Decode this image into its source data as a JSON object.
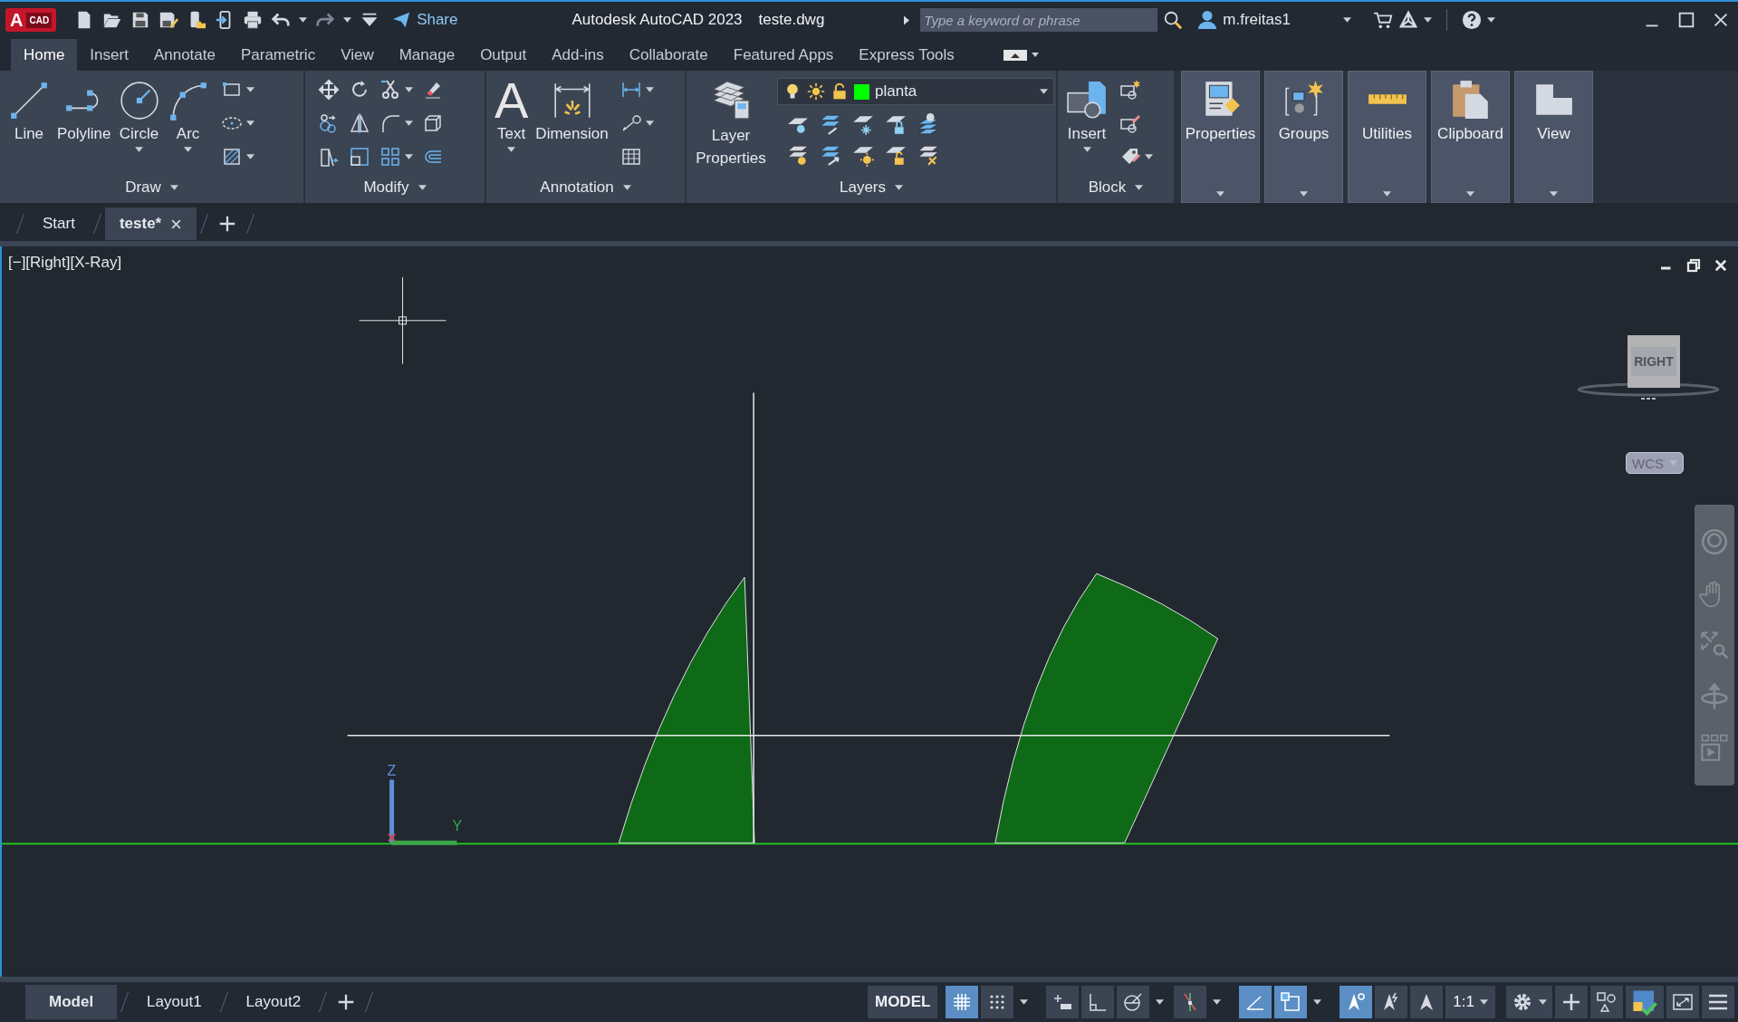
{
  "title_bar": {
    "app_badge": "A",
    "app_badge_sub": "CAD",
    "share": "Share",
    "title": "Autodesk AutoCAD 2023",
    "file_name": "teste.dwg",
    "search": {
      "placeholder": "Type a keyword or phrase"
    },
    "user": "m.freitas1"
  },
  "ribbon_tabs": [
    {
      "label": "Home",
      "selected": true
    },
    {
      "label": "Insert",
      "selected": false
    },
    {
      "label": "Annotate",
      "selected": false
    },
    {
      "label": "Parametric",
      "selected": false
    },
    {
      "label": "View",
      "selected": false
    },
    {
      "label": "Manage",
      "selected": false
    },
    {
      "label": "Output",
      "selected": false
    },
    {
      "label": "Add-ins",
      "selected": false
    },
    {
      "label": "Collaborate",
      "selected": false
    },
    {
      "label": "Featured Apps",
      "selected": false
    },
    {
      "label": "Express Tools",
      "selected": false
    }
  ],
  "ribbon_panels": [
    {
      "kind": "draw",
      "title": "Draw",
      "large_tools": [
        {
          "label": "Line",
          "dropdown": false
        },
        {
          "label": "Polyline",
          "dropdown": false
        },
        {
          "label": "Circle",
          "dropdown": true
        },
        {
          "label": "Arc",
          "dropdown": true
        }
      ]
    },
    {
      "kind": "modify",
      "title": "Modify"
    },
    {
      "kind": "annotation",
      "title": "Annotation",
      "large_tools": [
        {
          "label": "Text",
          "glyph": "A",
          "dropdown": true
        },
        {
          "label": "Dimension",
          "dropdown": false
        }
      ]
    },
    {
      "kind": "layers",
      "title": "Layers",
      "large_tools": [
        {
          "label": "Layer Properties",
          "dropdown": false
        }
      ],
      "layer_dropdown": {
        "value": "planta",
        "color": "#00ff00"
      }
    },
    {
      "kind": "block",
      "title": "Block",
      "large_tools": [
        {
          "label": "Insert",
          "dropdown": true
        }
      ]
    },
    {
      "kind": "collapsed",
      "title": "Properties"
    },
    {
      "kind": "collapsed",
      "title": "Groups"
    },
    {
      "kind": "collapsed",
      "title": "Utilities"
    },
    {
      "kind": "collapsed",
      "title": "Clipboard"
    },
    {
      "kind": "collapsed",
      "title": "View"
    }
  ],
  "file_tabs": [
    {
      "label": "Start",
      "selected": false,
      "closable": false
    },
    {
      "label": "teste*",
      "selected": true,
      "closable": true
    }
  ],
  "viewport": {
    "label": "[−][Right][X-Ray]",
    "viewcube": "RIGHT",
    "ucs_menu": "WCS",
    "ucs_axes": {
      "z": "Z",
      "y": "Y"
    }
  },
  "layout_tabs": [
    {
      "label": "Model",
      "selected": true
    },
    {
      "label": "Layout1",
      "selected": false
    },
    {
      "label": "Layout2",
      "selected": false
    }
  ],
  "status_bar": {
    "model": "MODEL",
    "scale": "1:1",
    "toggles": [
      {
        "kind": "grid",
        "on": true
      },
      {
        "kind": "snap",
        "on": false
      },
      {
        "kind": "infer",
        "on": false
      },
      {
        "kind": "ortho",
        "on": false
      },
      {
        "kind": "polar",
        "on": false
      },
      {
        "kind": "isodraft",
        "on": false
      },
      {
        "kind": "tracking",
        "on": true
      },
      {
        "kind": "osnap",
        "on": true
      },
      {
        "kind": "annovis",
        "on": true
      },
      {
        "kind": "autoscale",
        "on": false
      },
      {
        "kind": "annoscale",
        "on": false
      }
    ]
  }
}
